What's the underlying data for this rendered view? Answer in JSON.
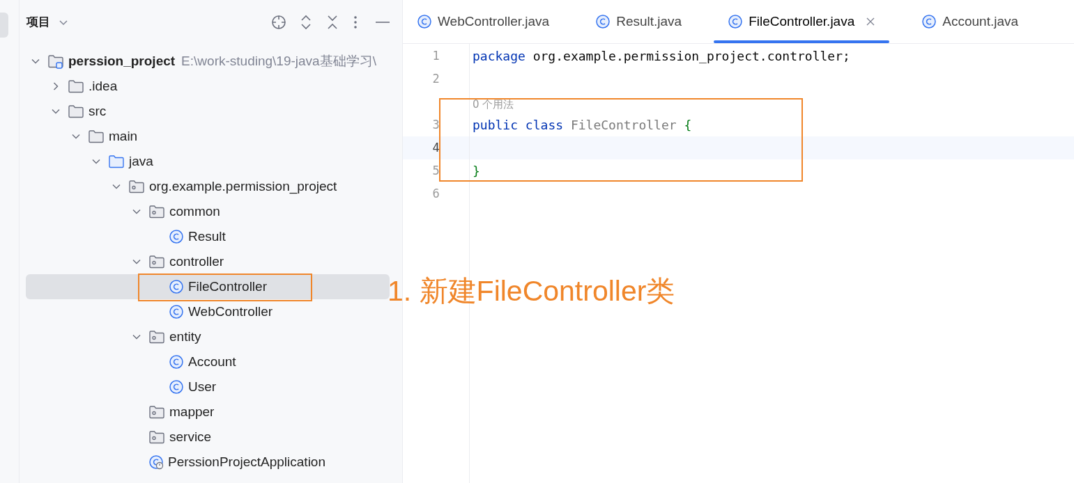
{
  "project_panel": {
    "title": "项目",
    "tree": [
      {
        "label": "perssion_project",
        "kind": "module",
        "path": "E:\\work-studing\\19-java基础学习\\",
        "expanded": true,
        "selected": false,
        "children": [
          {
            "label": ".idea",
            "kind": "folder",
            "expanded": false,
            "selected": false
          },
          {
            "label": "src",
            "kind": "folder",
            "expanded": true,
            "selected": false,
            "children": [
              {
                "label": "main",
                "kind": "folder",
                "expanded": true,
                "selected": false,
                "children": [
                  {
                    "label": "java",
                    "kind": "source",
                    "expanded": true,
                    "selected": false,
                    "children": [
                      {
                        "label": "org.example.permission_project",
                        "kind": "package",
                        "expanded": true,
                        "selected": false,
                        "children": [
                          {
                            "label": "common",
                            "kind": "package",
                            "expanded": true,
                            "selected": false,
                            "children": [
                              {
                                "label": "Result",
                                "kind": "class",
                                "selected": false
                              }
                            ]
                          },
                          {
                            "label": "controller",
                            "kind": "package",
                            "expanded": true,
                            "selected": false,
                            "children": [
                              {
                                "label": "FileController",
                                "kind": "class",
                                "selected": true
                              },
                              {
                                "label": "WebController",
                                "kind": "class",
                                "selected": false
                              }
                            ]
                          },
                          {
                            "label": "entity",
                            "kind": "package",
                            "expanded": true,
                            "selected": false,
                            "children": [
                              {
                                "label": "Account",
                                "kind": "class",
                                "selected": false
                              },
                              {
                                "label": "User",
                                "kind": "class",
                                "selected": false
                              }
                            ]
                          },
                          {
                            "label": "mapper",
                            "kind": "package",
                            "selected": false
                          },
                          {
                            "label": "service",
                            "kind": "package",
                            "selected": false
                          },
                          {
                            "label": "PerssionProjectApplication",
                            "kind": "app",
                            "selected": false
                          }
                        ]
                      }
                    ]
                  }
                ]
              }
            ]
          }
        ]
      }
    ]
  },
  "tabs": [
    {
      "label": "WebController.java",
      "selected": false
    },
    {
      "label": "Result.java",
      "selected": false
    },
    {
      "label": "FileController.java",
      "selected": true
    },
    {
      "label": "Account.java",
      "selected": false
    }
  ],
  "editor": {
    "lines": [
      {
        "number": "1",
        "current": false,
        "tokens": [
          {
            "kind": "keyword",
            "text": "package"
          },
          {
            "kind": "plain",
            "text": " org.example.permission_project.controller;"
          }
        ]
      },
      {
        "number": "2",
        "current": false
      },
      {
        "kind": "hint",
        "text": "0 个用法"
      },
      {
        "number": "3",
        "current": false,
        "tokens": [
          {
            "kind": "keyword",
            "text": "public"
          },
          {
            "kind": "keyword",
            "text": " class"
          },
          {
            "kind": "name",
            "text": " FileController"
          },
          {
            "kind": "brace",
            "text": " {"
          }
        ]
      },
      {
        "number": "4",
        "current": true
      },
      {
        "number": "5",
        "current": false,
        "tokens": [
          {
            "kind": "brace",
            "text": "}"
          }
        ]
      },
      {
        "number": "6",
        "current": false
      }
    ]
  },
  "annotation": {
    "text": "1. 新建FileController类"
  }
}
